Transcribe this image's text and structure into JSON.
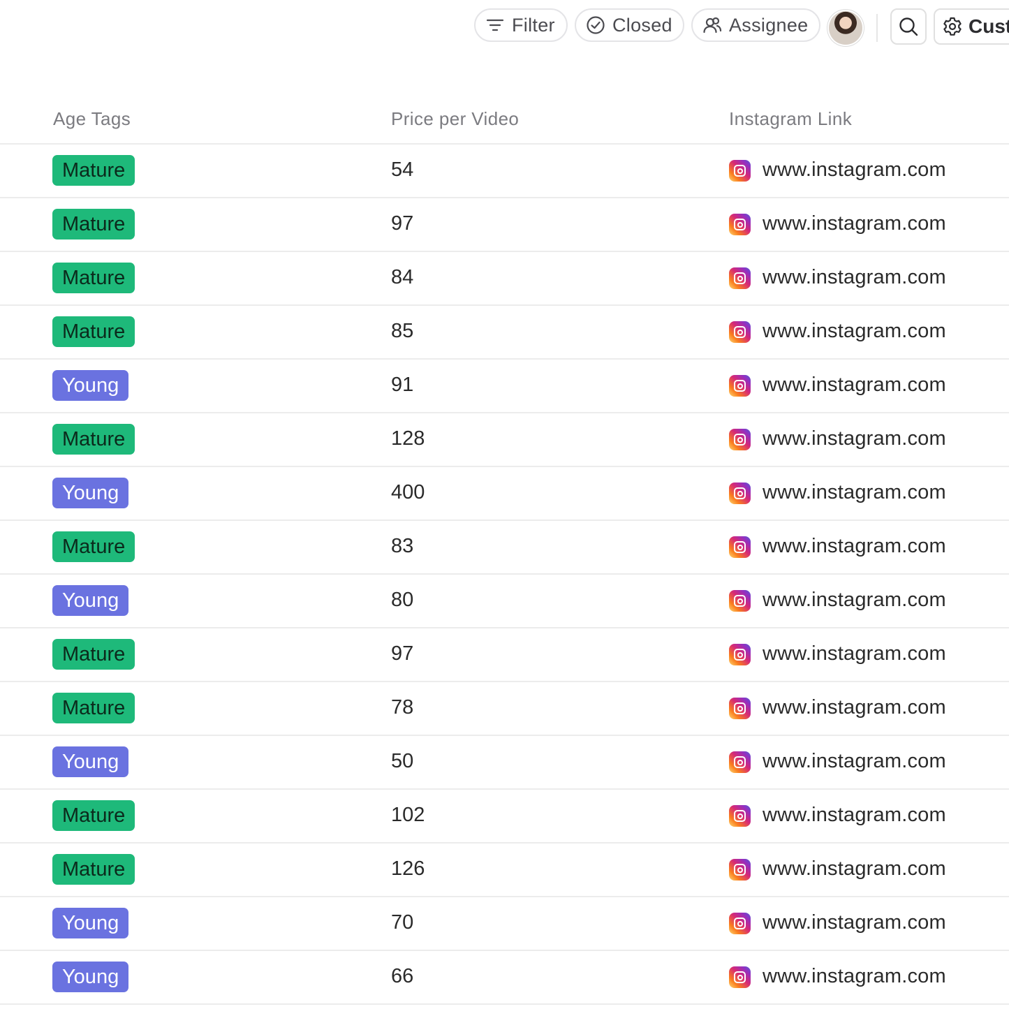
{
  "toolbar": {
    "filter_label": "Filter",
    "closed_label": "Closed",
    "assignee_label": "Assignee",
    "customize_label": "Cust"
  },
  "table": {
    "columns": [
      "Age Tags",
      "Price per Video",
      "Instagram Link"
    ],
    "rows": [
      {
        "age_tag": "Mature",
        "price": "54",
        "link": "www.instagram.com"
      },
      {
        "age_tag": "Mature",
        "price": "97",
        "link": "www.instagram.com"
      },
      {
        "age_tag": "Mature",
        "price": "84",
        "link": "www.instagram.com"
      },
      {
        "age_tag": "Mature",
        "price": "85",
        "link": "www.instagram.com"
      },
      {
        "age_tag": "Young",
        "price": "91",
        "link": "www.instagram.com"
      },
      {
        "age_tag": "Mature",
        "price": "128",
        "link": "www.instagram.com"
      },
      {
        "age_tag": "Young",
        "price": "400",
        "link": "www.instagram.com"
      },
      {
        "age_tag": "Mature",
        "price": "83",
        "link": "www.instagram.com"
      },
      {
        "age_tag": "Young",
        "price": "80",
        "link": "www.instagram.com"
      },
      {
        "age_tag": "Mature",
        "price": "97",
        "link": "www.instagram.com"
      },
      {
        "age_tag": "Mature",
        "price": "78",
        "link": "www.instagram.com"
      },
      {
        "age_tag": "Young",
        "price": "50",
        "link": "www.instagram.com"
      },
      {
        "age_tag": "Mature",
        "price": "102",
        "link": "www.instagram.com"
      },
      {
        "age_tag": "Mature",
        "price": "126",
        "link": "www.instagram.com"
      },
      {
        "age_tag": "Young",
        "price": "70",
        "link": "www.instagram.com"
      },
      {
        "age_tag": "Young",
        "price": "66",
        "link": "www.instagram.com"
      }
    ]
  },
  "colors": {
    "mature_tag": "#1eb97a",
    "young_tag": "#6a72e0"
  },
  "icons": [
    "filter-icon",
    "check-circle-icon",
    "assignee-icon",
    "search-icon",
    "gear-icon",
    "instagram-icon"
  ]
}
